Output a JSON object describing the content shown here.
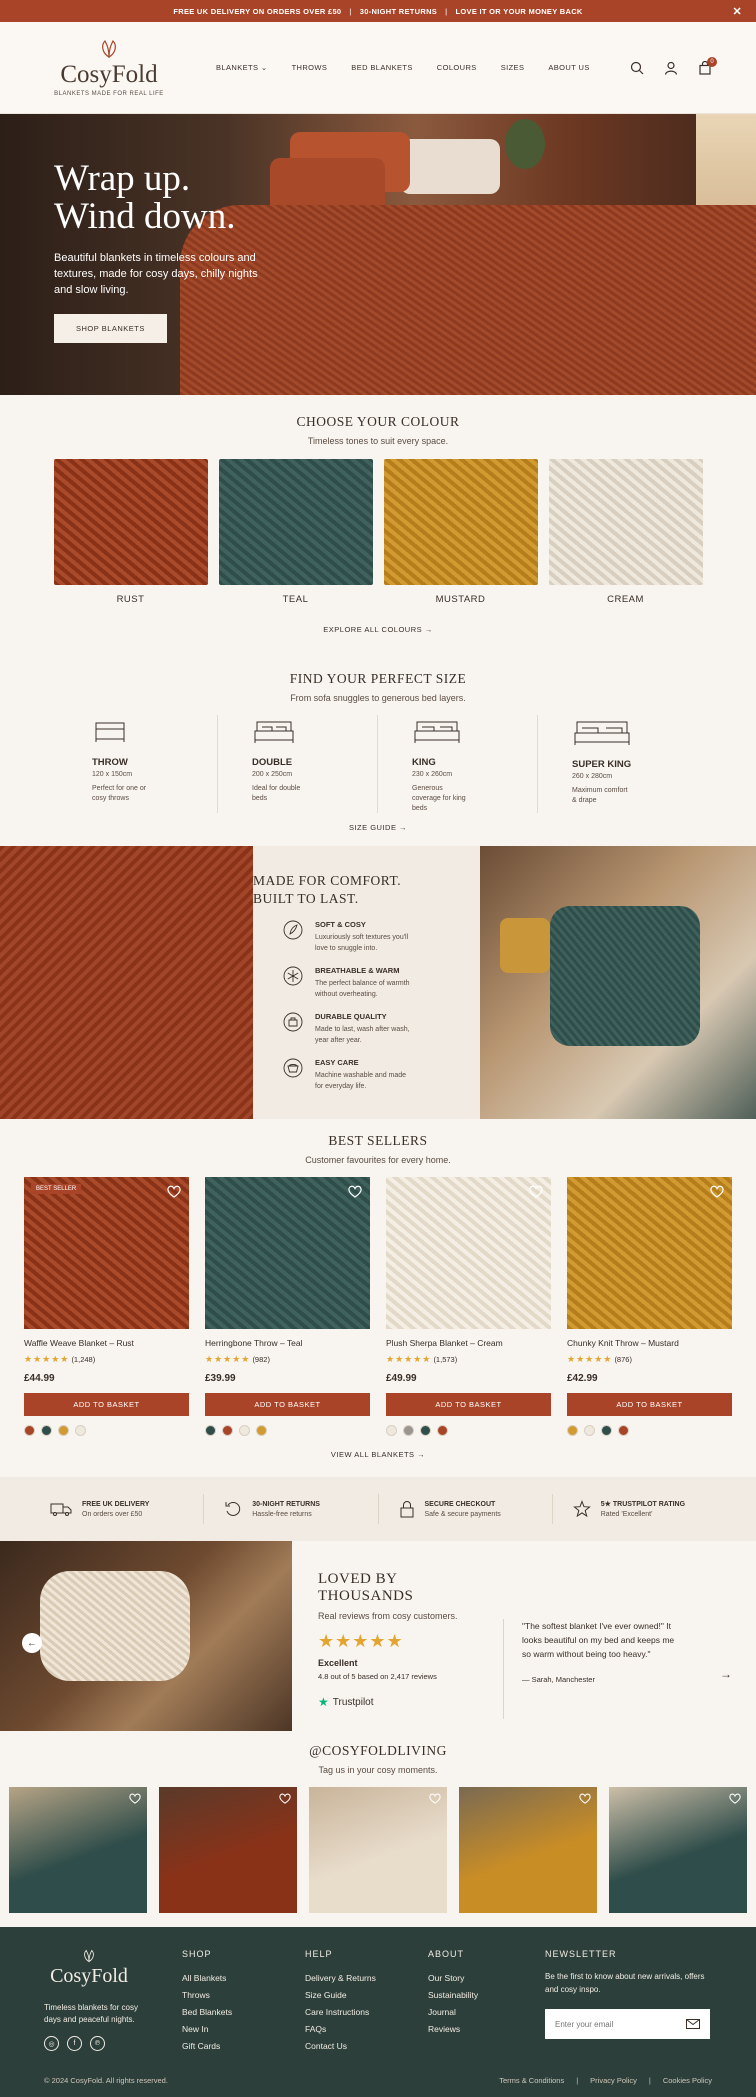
{
  "announcement": {
    "items": [
      "FREE UK DELIVERY ON ORDERS OVER £50",
      "30-NIGHT RETURNS",
      "LOVE IT OR YOUR MONEY BACK"
    ],
    "close": "✕"
  },
  "header": {
    "logo": "CosyFold",
    "tagline": "BLANKETS MADE FOR REAL LIFE",
    "nav": [
      "BLANKETS",
      "THROWS",
      "BED BLANKETS",
      "COLOURS",
      "SIZES",
      "ABOUT US"
    ],
    "cart_count": "0"
  },
  "hero": {
    "title_line1": "Wrap up.",
    "title_line2": "Wind down.",
    "text": "Beautiful blankets in timeless colours and textures, made for cosy days, chilly nights and slow living.",
    "cta": "SHOP BLANKETS"
  },
  "colours": {
    "title": "CHOOSE YOUR COLOUR",
    "subtitle": "Timeless tones to suit every space.",
    "items": [
      {
        "label": "RUST",
        "c1": "#8a3218",
        "c2": "#a94a2a"
      },
      {
        "label": "TEAL",
        "c1": "#2f4d4a",
        "c2": "#40625d"
      },
      {
        "label": "MUSTARD",
        "c1": "#b57d1c",
        "c2": "#d29b31"
      },
      {
        "label": "CREAM",
        "c1": "#d9cfc0",
        "c2": "#efe8dc"
      }
    ],
    "link": "EXPLORE ALL COLOURS →"
  },
  "sizes": {
    "title": "FIND YOUR PERFECT SIZE",
    "subtitle": "From sofa snuggles to generous bed layers.",
    "items": [
      {
        "name": "THROW",
        "dims": "120 x 150cm",
        "desc": "Perfect for one or cosy throws"
      },
      {
        "name": "DOUBLE",
        "dims": "200 x 250cm",
        "desc": "Ideal for double beds"
      },
      {
        "name": "KING",
        "dims": "230 x 260cm",
        "desc": "Generous coverage for king beds"
      },
      {
        "name": "SUPER KING",
        "dims": "260 x 280cm",
        "desc": "Maximum comfort & drape"
      }
    ],
    "link": "SIZE GUIDE →"
  },
  "comfort": {
    "title_line1": "MADE FOR COMFORT.",
    "title_line2": "BUILT TO LAST.",
    "features": [
      {
        "title": "SOFT & COSY",
        "desc": "Luxuriously soft textures you'll love to snuggle into."
      },
      {
        "title": "BREATHABLE & WARM",
        "desc": "The perfect balance of warmth without overheating."
      },
      {
        "title": "DURABLE QUALITY",
        "desc": "Made to last, wash after wash, year after year."
      },
      {
        "title": "EASY CARE",
        "desc": "Machine washable and made for everyday life."
      }
    ]
  },
  "best": {
    "title": "BEST SELLERS",
    "subtitle": "Customer favourites for every home.",
    "products": [
      {
        "name": "Waffle Weave Blanket – Rust",
        "stars": "★★★★★",
        "reviews": "(1,248)",
        "price": "£44.99",
        "add": "ADD TO BASKET",
        "badge": "BEST SELLER",
        "c1": "#8a3218",
        "c2": "#a94a2a",
        "swatches": [
          "#a94428",
          "#2f4d4a",
          "#d29b31",
          "#efe8dc"
        ]
      },
      {
        "name": "Herringbone Throw – Teal",
        "stars": "★★★★★",
        "reviews": "(982)",
        "price": "£39.99",
        "add": "ADD TO BASKET",
        "badge": "",
        "c1": "#2f4d4a",
        "c2": "#40625d",
        "swatches": [
          "#2f4d4a",
          "#a94428",
          "#efe8dc",
          "#d29b31"
        ]
      },
      {
        "name": "Plush Sherpa Blanket – Cream",
        "stars": "★★★★★",
        "reviews": "(1,573)",
        "price": "£49.99",
        "add": "ADD TO BASKET",
        "badge": "",
        "c1": "#e3d9c9",
        "c2": "#f4eee4",
        "swatches": [
          "#efe8dc",
          "#9a958e",
          "#2f4d4a",
          "#a94428"
        ]
      },
      {
        "name": "Chunky Knit Throw – Mustard",
        "stars": "★★★★★",
        "reviews": "(876)",
        "price": "£42.99",
        "add": "ADD TO BASKET",
        "badge": "",
        "c1": "#b57d1c",
        "c2": "#d29b31",
        "swatches": [
          "#d29b31",
          "#efe8dc",
          "#2f4d4a",
          "#a94428"
        ]
      }
    ],
    "link": "VIEW ALL BLANKETS →"
  },
  "benefits": [
    {
      "title": "FREE UK DELIVERY",
      "desc": "On orders over £50",
      "icon": "truck-icon"
    },
    {
      "title": "30-NIGHT RETURNS",
      "desc": "Hassle-free returns",
      "icon": "returns-icon"
    },
    {
      "title": "SECURE CHECKOUT",
      "desc": "Safe & secure payments",
      "icon": "lock-icon"
    },
    {
      "title": "5★ TRUSTPILOT RATING",
      "desc": "Rated 'Excellent'",
      "icon": "star-icon"
    }
  ],
  "loved": {
    "title": "LOVED BY THOUSANDS",
    "subtitle": "Real reviews from cosy customers.",
    "stars": "★★★★★",
    "rating_label": "Excellent",
    "rating_text": "4.8 out of 5 based on 2,417 reviews",
    "trustpilot": "Trustpilot",
    "quote": "\"The softest blanket I've ever owned!\" It looks beautiful on my bed and keeps me so warm without being too heavy.\"",
    "author": "— Sarah, Manchester"
  },
  "instagram": {
    "handle": "@COSYFOLDLIVING",
    "subtitle": "Tag us in your cosy moments.",
    "tiles": [
      {
        "c1": "#2f4d4a",
        "c2": "#b6a486"
      },
      {
        "c1": "#8a3218",
        "c2": "#5a3a2a"
      },
      {
        "c1": "#e8dccb",
        "c2": "#c9b49a"
      },
      {
        "c1": "#c98d26",
        "c2": "#7a6a52"
      },
      {
        "c1": "#2f4d4a",
        "c2": "#cdbfa8"
      }
    ]
  },
  "footer": {
    "logo": "CosyFold",
    "desc": "Timeless blankets for cosy days and peaceful nights.",
    "social": [
      "◎",
      "f",
      "℗"
    ],
    "shop": {
      "title": "SHOP",
      "items": [
        "All Blankets",
        "Throws",
        "Bed Blankets",
        "New In",
        "Gift Cards"
      ]
    },
    "help": {
      "title": "HELP",
      "items": [
        "Delivery & Returns",
        "Size Guide",
        "Care Instructions",
        "FAQs",
        "Contact Us"
      ]
    },
    "about": {
      "title": "ABOUT",
      "items": [
        "Our Story",
        "Sustainability",
        "Journal",
        "Reviews"
      ]
    },
    "newsletter": {
      "title": "NEWSLETTER",
      "text": "Be the first to know about new arrivals, offers and cosy inspo.",
      "placeholder": "Enter your email"
    },
    "copyright": "© 2024 CosyFold. All rights reserved.",
    "legal": [
      "Terms & Conditions",
      "Privacy Policy",
      "Cookies Policy"
    ]
  }
}
